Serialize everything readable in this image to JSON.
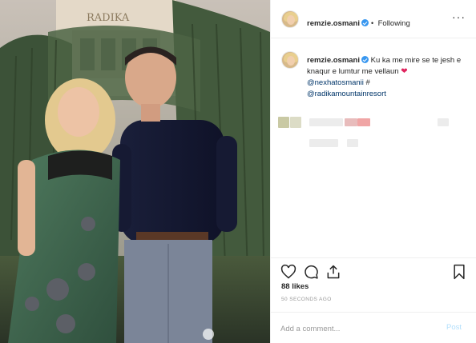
{
  "header": {
    "username": "remzie.osmani",
    "separator": "•",
    "follow_status": "Following",
    "more_icon": "···"
  },
  "caption": {
    "username": "remzie.osmani",
    "text": "Ku ka me mire se te jesh e knaqur e lumtur me vellaun",
    "emoji": "❤",
    "mention_1": "@nexhatosmanii",
    "hash": "#",
    "mention_2": "@radikamountainresort"
  },
  "photo": {
    "sign_text": "RADIKA"
  },
  "actions": {
    "icons": [
      "heart-outline-icon",
      "comment-icon",
      "share-icon",
      "bookmark-icon"
    ]
  },
  "likes": "88 likes",
  "timestamp": "50 SECONDS AGO",
  "comment_box": {
    "placeholder": "Add a comment...",
    "post_label": "Post"
  },
  "colors": {
    "verified": "#3897f0",
    "mention": "#003569",
    "heart": "#e0245e",
    "post_disabled": "#b2dffc"
  }
}
